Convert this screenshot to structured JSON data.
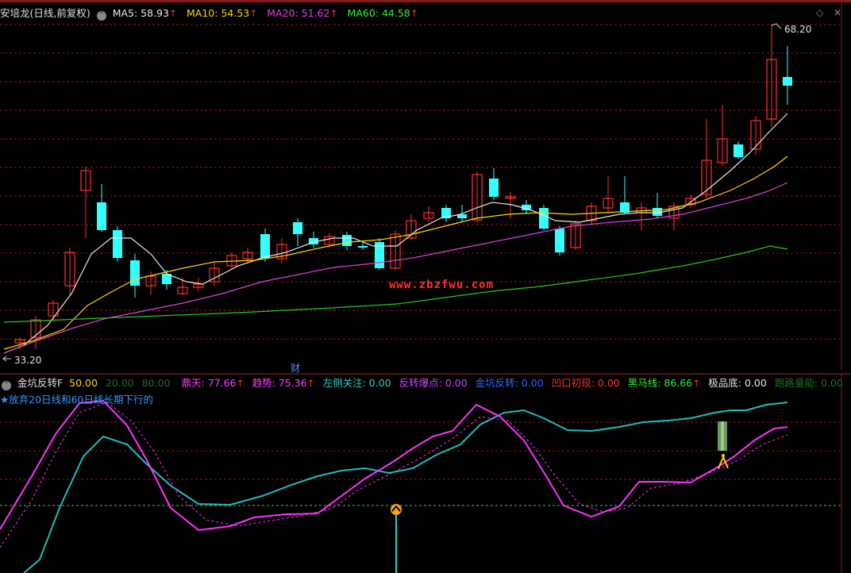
{
  "header": {
    "stock_name": "安培龙(日线,前复权)",
    "ma": [
      {
        "label": "MA5: 58.93",
        "color": "#e8e8e8"
      },
      {
        "label": "MA10: 54.53",
        "color": "#ffd700"
      },
      {
        "label": "MA20: 51.62",
        "color": "#e040e0"
      },
      {
        "label": "MA60: 44.58",
        "color": "#33ee33"
      }
    ],
    "up_arrow": "↑"
  },
  "window_controls": {
    "diamond": "◇",
    "close": "✕"
  },
  "price_labels": {
    "high": "68.20",
    "low": "33.20"
  },
  "cai_marker": "财",
  "watermark": "www.zbzfwu.com",
  "indicator": {
    "name": "金坑反转F",
    "params": [
      "50.00",
      "20.00",
      "80.00"
    ],
    "items": [
      {
        "label": "鼎天: 77.66",
        "color": "#ff40ff",
        "arrow": true
      },
      {
        "label": "趋势: 75.36",
        "color": "#ff40ff",
        "arrow": true
      },
      {
        "label": "左侧关注: 0.00",
        "color": "#33cccc",
        "arrow": false
      },
      {
        "label": "反转爆点: 0.00",
        "color": "#cc44ff",
        "arrow": false
      },
      {
        "label": "金坑反转: 0.00",
        "color": "#3366ff",
        "arrow": false
      },
      {
        "label": "凹口初现: 0.00",
        "color": "#ff3030",
        "arrow": false
      },
      {
        "label": "黑马线: 86.66",
        "color": "#33ee33",
        "arrow": true
      },
      {
        "label": "极品底: 0.00",
        "color": "#e8e8e8",
        "arrow": false
      },
      {
        "label": "跑路量能: 0.00",
        "color": "#1e6e1e",
        "arrow": false
      }
    ],
    "note": "★放弃20日线和60日线长期下行的"
  },
  "colors": {
    "up": "#ff3030",
    "down": "#33ffff",
    "ma5": "#e8e8e8",
    "ma10": "#ffd700",
    "ma20": "#e040e0",
    "ma60": "#22cc22",
    "grid": "#8b1a1a",
    "cyan_line": "#22bbbb",
    "mag_line": "#ff33ff"
  }
}
